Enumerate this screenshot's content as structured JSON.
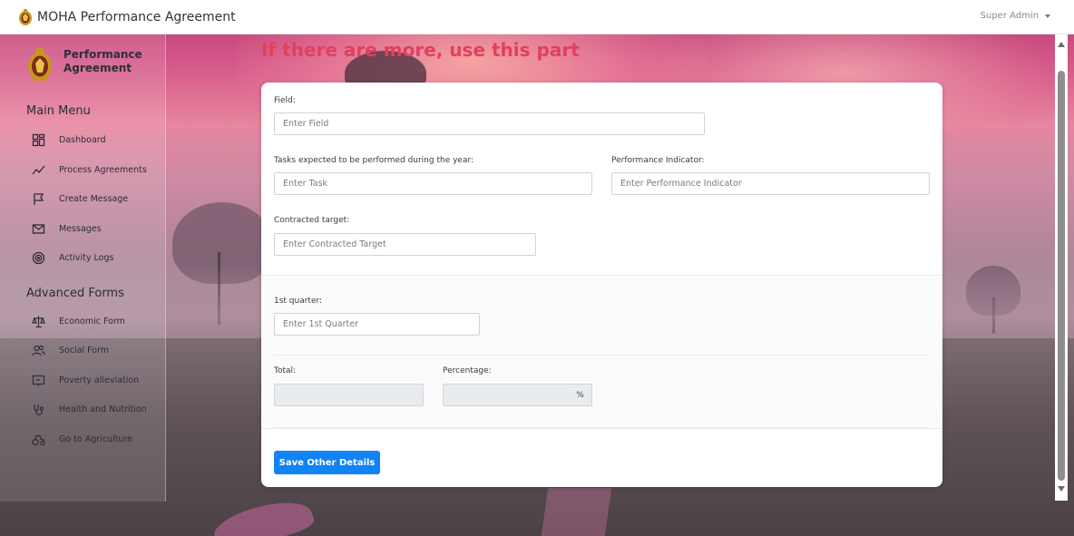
{
  "app": {
    "title": "MOHA Performance Agreement",
    "user": "Super Admin"
  },
  "sidebar": {
    "brand": [
      "Performance",
      "Agreement"
    ],
    "main_heading": "Main Menu",
    "main_items": [
      {
        "label": "Dashboard",
        "icon": "dashboard-icon"
      },
      {
        "label": "Process Agreements",
        "icon": "trend-line-icon"
      },
      {
        "label": "Create Message",
        "icon": "flag-icon"
      },
      {
        "label": "Messages",
        "icon": "mail-icon"
      },
      {
        "label": "Activity Logs",
        "icon": "target-icon"
      }
    ],
    "advanced_heading": "Advanced Forms",
    "advanced_items": [
      {
        "label": "Economic Form",
        "icon": "scale-icon"
      },
      {
        "label": "Social Form",
        "icon": "users-icon"
      },
      {
        "label": "Poverty alleviation",
        "icon": "presentation-icon"
      },
      {
        "label": "Health and Nutrition",
        "icon": "health-icon"
      },
      {
        "label": "Go to Agriculture",
        "icon": "tractor-icon"
      }
    ]
  },
  "page": {
    "section_title": "If there are more, use this part"
  },
  "form": {
    "field": {
      "label": "Field:",
      "placeholder": "Enter Field"
    },
    "task": {
      "label": "Tasks expected to be performed during the year:",
      "placeholder": "Enter Task"
    },
    "indicator": {
      "label": "Performance Indicator:",
      "placeholder": "Enter Performance Indicator"
    },
    "target": {
      "label": "Contracted target:",
      "placeholder": "Enter Contracted Target"
    },
    "quarter1": {
      "label": "1st quarter:",
      "placeholder": "Enter 1st Quarter"
    },
    "total": {
      "label": "Total:",
      "value": ""
    },
    "percentage": {
      "label": "Percentage:",
      "value": "",
      "suffix": "%"
    },
    "save_label": "Save Other Details"
  },
  "colors": {
    "accent": "#1183f5",
    "section_title": "#e0405f"
  }
}
